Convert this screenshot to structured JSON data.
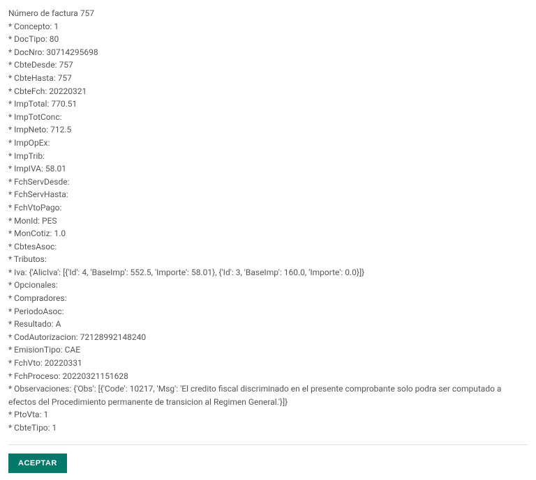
{
  "header": {
    "label": "Número de factura",
    "number": "757"
  },
  "prefix": " * ",
  "sep": ": ",
  "fields": [
    {
      "key": "Concepto",
      "value": "1"
    },
    {
      "key": "DocTipo",
      "value": "80"
    },
    {
      "key": "DocNro",
      "value": "30714295698"
    },
    {
      "key": "CbteDesde",
      "value": "757"
    },
    {
      "key": "CbteHasta",
      "value": "757"
    },
    {
      "key": "CbteFch",
      "value": "20220321"
    },
    {
      "key": "ImpTotal",
      "value": "770.51"
    },
    {
      "key": "ImpTotConc",
      "value": ""
    },
    {
      "key": "ImpNeto",
      "value": "712.5"
    },
    {
      "key": "ImpOpEx",
      "value": ""
    },
    {
      "key": "ImpTrib",
      "value": ""
    },
    {
      "key": "ImpIVA",
      "value": "58.01"
    },
    {
      "key": "FchServDesde",
      "value": ""
    },
    {
      "key": "FchServHasta",
      "value": ""
    },
    {
      "key": "FchVtoPago",
      "value": ""
    },
    {
      "key": "MonId",
      "value": "PES"
    },
    {
      "key": "MonCotiz",
      "value": "1.0"
    },
    {
      "key": "CbtesAsoc",
      "value": ""
    },
    {
      "key": "Tributos",
      "value": ""
    },
    {
      "key": "Iva",
      "value": "{'AlicIva': [{'Id': 4, 'BaseImp': 552.5, 'Importe': 58.01}, {'Id': 3, 'BaseImp': 160.0, 'Importe': 0.0}]}"
    },
    {
      "key": "Opcionales",
      "value": ""
    },
    {
      "key": "Compradores",
      "value": ""
    },
    {
      "key": "PeriodoAsoc",
      "value": ""
    },
    {
      "key": "Resultado",
      "value": "A"
    },
    {
      "key": "CodAutorizacion",
      "value": "72128992148240"
    },
    {
      "key": "EmisionTipo",
      "value": "CAE"
    },
    {
      "key": "FchVto",
      "value": "20220331"
    },
    {
      "key": "FchProceso",
      "value": "20220321151628"
    },
    {
      "key": "Observaciones",
      "value": "{'Obs': [{'Code': 10217, 'Msg': 'El credito fiscal discriminado en el presente comprobante solo podra ser computado a efectos del Procedimiento permanente de transicion al Regimen General.'}]}"
    },
    {
      "key": "PtoVta",
      "value": "1"
    },
    {
      "key": "CbteTipo",
      "value": "1"
    }
  ],
  "button": {
    "accept": "Aceptar"
  }
}
